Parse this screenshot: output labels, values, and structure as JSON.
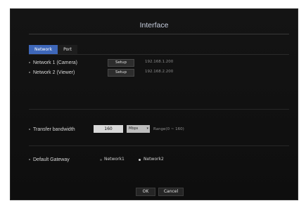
{
  "window": {
    "title": "Interface"
  },
  "tabs": [
    {
      "label": "Network",
      "active": true
    },
    {
      "label": "Port",
      "active": false
    }
  ],
  "network_rows": [
    {
      "label": "Network 1 (Camera)",
      "button": "Setup",
      "ip": "192.168.1.200"
    },
    {
      "label": "Network 2 (Viewer)",
      "button": "Setup",
      "ip": "192.168.2.200"
    }
  ],
  "transfer": {
    "label": "Transfer bandwidth",
    "value": "160",
    "unit": "Mbps",
    "range": "Range(0 ~ 160)"
  },
  "gateway": {
    "label": "Default Gateway",
    "options": [
      {
        "label": "Network1",
        "selected": false
      },
      {
        "label": "Network2",
        "selected": true
      }
    ]
  },
  "footer": {
    "ok": "OK",
    "cancel": "Cancel"
  },
  "colors": {
    "panel": "#121212",
    "tab_active": "#3e67b9",
    "title": "#c9d0e0"
  }
}
